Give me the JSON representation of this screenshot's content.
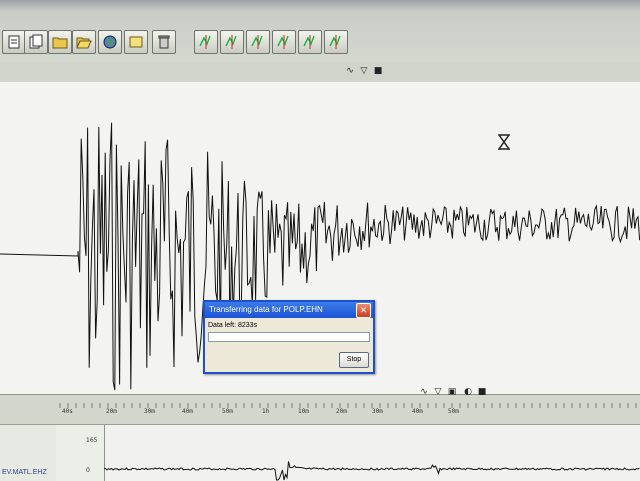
{
  "toolbar": {
    "buttons": [
      {
        "name": "page-icon"
      },
      {
        "name": "pages-icon"
      },
      {
        "name": "folder-icon"
      },
      {
        "name": "open-folder-icon"
      },
      {
        "name": "globe-icon"
      },
      {
        "name": "note-icon"
      },
      {
        "name": "trash-icon"
      },
      {
        "name": "pick-first-icon"
      },
      {
        "name": "pick-second-icon"
      },
      {
        "name": "pick-third-icon"
      },
      {
        "name": "pick-fourth-icon"
      },
      {
        "name": "pick-fifth-icon"
      },
      {
        "name": "pick-sixth-icon"
      }
    ]
  },
  "dialog": {
    "title": "Transferring data for POLP.EHN",
    "message": "Data left: 8233s",
    "stop_label": "Stop",
    "progress": 0
  },
  "timescale": {
    "labels": [
      "40s",
      "20m",
      "30m",
      "40m",
      "50m",
      "1h",
      "10m",
      "20m",
      "30m",
      "40m",
      "50m"
    ]
  },
  "lower_scale": {
    "top": "165",
    "bottom": "0"
  },
  "station_label": "EV.MATL.EHZ"
}
